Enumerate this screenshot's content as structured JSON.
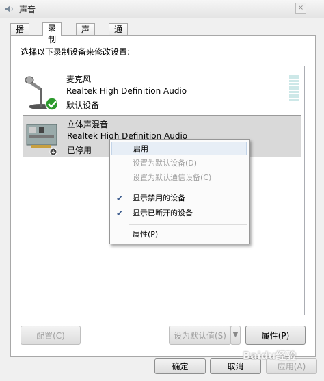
{
  "window": {
    "title": "声音",
    "close_label": "×"
  },
  "tabs": [
    {
      "label": "播放"
    },
    {
      "label": "录制"
    },
    {
      "label": "声音"
    },
    {
      "label": "通信"
    }
  ],
  "instruction": "选择以下录制设备来修改设置:",
  "devices": [
    {
      "name": "麦克风",
      "driver": "Realtek High Definition Audio",
      "status": "默认设备"
    },
    {
      "name": "立体声混音",
      "driver": "Realtek High Definition Audio",
      "status": "已停用"
    }
  ],
  "context_menu": {
    "items": [
      {
        "label": "启用",
        "disabled": false
      },
      {
        "label": "设置为默认设备(D)",
        "disabled": true
      },
      {
        "label": "设置为默认通信设备(C)",
        "disabled": true
      },
      {
        "label": "显示禁用的设备",
        "checked": true
      },
      {
        "label": "显示已断开的设备",
        "checked": true
      },
      {
        "label": "属性(P)",
        "disabled": false
      }
    ]
  },
  "buttons": {
    "configure": "配置(C)",
    "set_default": "设为默认值(S)",
    "properties": "属性(P)",
    "ok": "确定",
    "cancel": "取消",
    "apply": "应用(A)"
  },
  "watermark": "Baidu经验"
}
